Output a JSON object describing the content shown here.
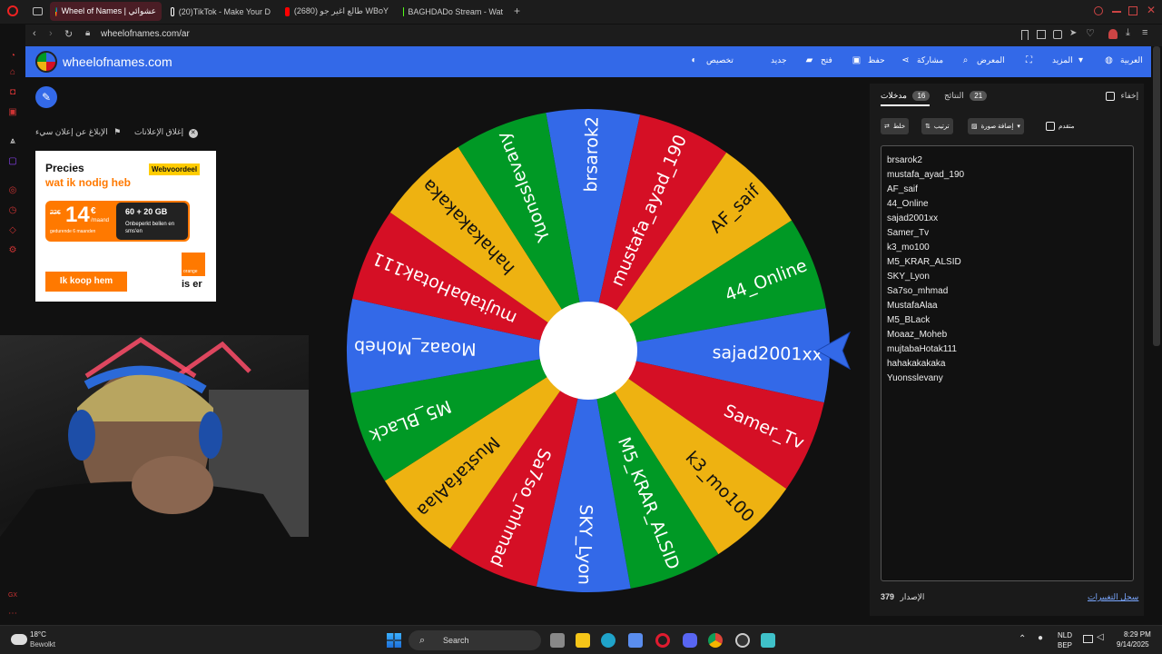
{
  "browser": {
    "tabs": [
      {
        "label": "Wheel of Names | عشوائي",
        "active": true,
        "color": "#3369e8"
      },
      {
        "label": "(20)TikTok - Make Your D",
        "active": false,
        "color": "#ffffff"
      },
      {
        "label": "طالع اغير جو (2680) WBoY",
        "active": false,
        "color": "#ff0000"
      },
      {
        "label": "BAGHDADo Stream - Wat",
        "active": false,
        "color": "#53fc18"
      }
    ],
    "new_tab": "+",
    "url": "wheelofnames.com/ar"
  },
  "site": {
    "title": "wheelofnames.com",
    "nav": {
      "customize": "تخصيص",
      "new": "جديد",
      "open": "فتح",
      "save": "حفظ",
      "share": "مشاركة",
      "gallery": "المعرض",
      "more": "المزيد",
      "language": "العربية"
    }
  },
  "ads": {
    "close_ads": "إغلاق الإعلانات",
    "report_ad": "الإبلاغ عن إعلان سيء",
    "headline1": "Precies",
    "headline2": "wat ik nodig heb",
    "tag": "Webvoordeel",
    "old_price": "22€",
    "price": "14",
    "price_unit": "€",
    "per": "/maand",
    "duration": "gedurende 6 maanden",
    "bundle": "60 + 20 GB",
    "bundle_sub": "Onbeperkt bellen en sms'en",
    "cta": "Ik koop hem",
    "brand": "orange",
    "brand_tagline": "is er"
  },
  "wheel": {
    "colors": [
      "#3369e8",
      "#d50f25",
      "#eeb211",
      "#009925"
    ],
    "slices": [
      "brsarok2",
      "mustafa_ayad_190",
      "AF_saif",
      "44_Online",
      "sajad2001xx",
      "Samer_Tv",
      "k3_mo100",
      "M5_KRAR_ALSID",
      "SKY_Lyon",
      "Sa7so_mhmad",
      "MustafaAlaa",
      "M5_BLack",
      "Moaaz_Moheb",
      "mujtabaHotak111",
      "hahakakakaka",
      "Yuonsslevany"
    ]
  },
  "panel": {
    "hide_label": "إخفاء",
    "entries_tab": "مدخلات",
    "entries_count": "16",
    "results_tab": "النتائج",
    "results_count": "21",
    "shuffle": "خلط",
    "sort": "ترتيب",
    "add_image": "إضافة صورة",
    "advanced": "متقدم",
    "entries": [
      "brsarok2",
      "mustafa_ayad_190",
      "AF_saif",
      "44_Online",
      "sajad2001xx",
      "Samer_Tv",
      "k3_mo100",
      "M5_KRAR_ALSID",
      "SKY_Lyon",
      "Sa7so_mhmad",
      "MustafaAlaa",
      "M5_BLack",
      "Moaaz_Moheb",
      "mujtabaHotak111",
      "hahakakakaka",
      "Yuonsslevany"
    ],
    "version_label": "الإصدار",
    "version": "379",
    "changelog": "سجل التغييرات"
  },
  "taskbar": {
    "weather_temp": "18°C",
    "weather_desc": "Bewolkt",
    "search": "Search",
    "lang1": "NLD",
    "lang2": "BEP",
    "time": "8:29 PM",
    "date": "9/14/2025"
  }
}
